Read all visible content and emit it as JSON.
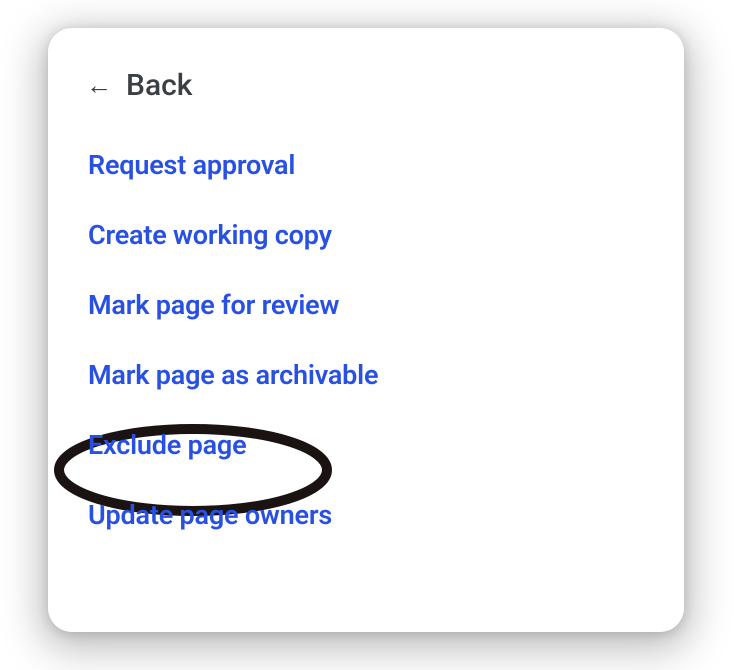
{
  "back": {
    "label": "Back"
  },
  "menu": {
    "items": [
      {
        "label": "Request approval"
      },
      {
        "label": "Create working copy"
      },
      {
        "label": "Mark page for review"
      },
      {
        "label": "Mark page as archivable"
      },
      {
        "label": "Exclude page"
      },
      {
        "label": "Update page owners"
      }
    ]
  }
}
